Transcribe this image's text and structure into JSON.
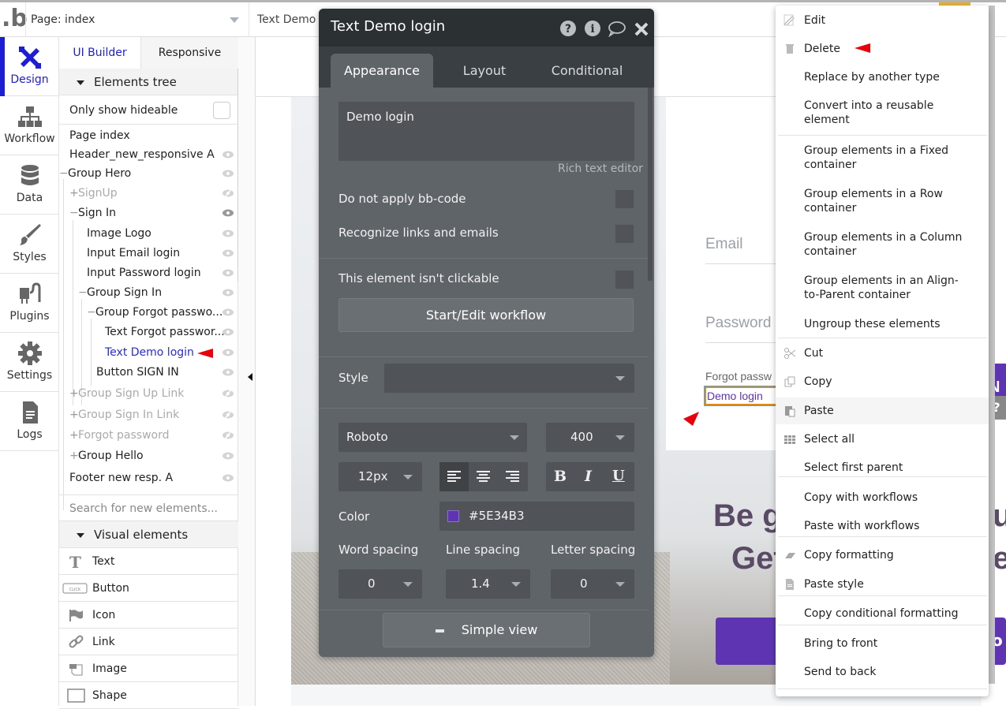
{
  "topbar": {
    "logo": ".b",
    "page_select": "Page: index",
    "element_select": "Text Demo"
  },
  "leftnav": [
    {
      "label": "Design",
      "icon": "design-icon",
      "active": true
    },
    {
      "label": "Workflow",
      "icon": "workflow-icon"
    },
    {
      "label": "Data",
      "icon": "database-icon"
    },
    {
      "label": "Styles",
      "icon": "brush-icon"
    },
    {
      "label": "Plugins",
      "icon": "plug-icon"
    },
    {
      "label": "Settings",
      "icon": "gear-icon"
    },
    {
      "label": "Logs",
      "icon": "document-icon"
    }
  ],
  "panel": {
    "tabs": [
      "UI Builder",
      "Responsive"
    ],
    "elements_tree_heading": "Elements tree",
    "only_show_hideable": "Only show hideable",
    "tree": [
      {
        "label": "Page index",
        "prefix": "",
        "state": "normal",
        "eye": false
      },
      {
        "label": "Header_new_responsive A",
        "prefix": "",
        "state": "normal",
        "eye": "visible"
      },
      {
        "label": "Group Hero",
        "prefix": "−",
        "state": "normal",
        "eye": "visible"
      },
      {
        "label": "SignUp",
        "prefix": "+",
        "state": "hidden",
        "eye": "hidden"
      },
      {
        "label": "Sign In",
        "prefix": "−",
        "state": "normal",
        "eye": "visible-dark"
      },
      {
        "label": "Image Logo",
        "prefix": "",
        "state": "normal",
        "eye": "visible"
      },
      {
        "label": "Input Email login",
        "prefix": "",
        "state": "normal",
        "eye": "visible"
      },
      {
        "label": "Input Password login",
        "prefix": "",
        "state": "normal",
        "eye": "visible"
      },
      {
        "label": "Group Sign In",
        "prefix": "−",
        "state": "normal",
        "eye": "visible"
      },
      {
        "label": "Group Forgot passwo...",
        "prefix": "−",
        "state": "normal",
        "eye": "visible"
      },
      {
        "label": "Text Forgot passwor...",
        "prefix": "",
        "state": "normal",
        "eye": "visible"
      },
      {
        "label": "Text Demo login",
        "prefix": "",
        "state": "selected",
        "eye": "visible"
      },
      {
        "label": "Button SIGN IN",
        "prefix": "",
        "state": "normal",
        "eye": "visible"
      },
      {
        "label": "Group Sign Up Link",
        "prefix": "+",
        "state": "hidden",
        "eye": "hidden"
      },
      {
        "label": "Group Sign In Link",
        "prefix": "+",
        "state": "hidden",
        "eye": "hidden"
      },
      {
        "label": "Forgot password",
        "prefix": "+",
        "state": "hidden",
        "eye": "hidden"
      },
      {
        "label": "Group Hello",
        "prefix": "+",
        "state": "normal",
        "eye": "visible"
      },
      {
        "label": "Footer new resp. A",
        "prefix": "",
        "state": "normal",
        "eye": "visible"
      }
    ],
    "search_placeholder": "Search for new elements...",
    "visual_elements_heading": "Visual elements",
    "visual_elements": [
      {
        "label": "Text",
        "icon": "text-icon"
      },
      {
        "label": "Button",
        "icon": "button-icon"
      },
      {
        "label": "Icon",
        "icon": "flag-icon"
      },
      {
        "label": "Link",
        "icon": "link-icon"
      },
      {
        "label": "Image",
        "icon": "image-icon"
      },
      {
        "label": "Shape",
        "icon": "shape-icon"
      }
    ]
  },
  "editor": {
    "title": "Text Demo login",
    "tabs": [
      "Appearance",
      "Layout",
      "Conditional"
    ],
    "active_tab": "Appearance",
    "content_text": "Demo login",
    "rich_text_label": "Rich text editor",
    "checkboxes": [
      {
        "label": "Do not apply bb-code",
        "checked": false
      },
      {
        "label": "Recognize links and emails",
        "checked": false
      },
      {
        "label": "This element isn't clickable",
        "checked": false
      }
    ],
    "workflow_button": "Start/Edit workflow",
    "style_label": "Style",
    "style_value": "",
    "font_family": "Roboto",
    "font_weight": "400",
    "font_size": "12px",
    "alignment": "left",
    "format_buttons": [
      "B",
      "I",
      "U"
    ],
    "color_label": "Color",
    "color_value": "#5E34B3",
    "word_spacing_label": "Word spacing",
    "line_spacing_label": "Line spacing",
    "letter_spacing_label": "Letter spacing",
    "word_spacing": "0",
    "line_spacing": "1.4",
    "letter_spacing": "0",
    "simple_view_button": "Simple view"
  },
  "canvas": {
    "email_placeholder": "Email",
    "password_placeholder": "Password",
    "forgot_text": "Forgot passw",
    "demo_login_text": "Demo login",
    "signin_btn_partial": "N",
    "hero_title_line1": "Be g",
    "hero_title_line1_right": "u",
    "hero_title_line2": "Get",
    "hero_title_line2_right": "e",
    "hero_btn_partial": "o",
    "help": "?"
  },
  "context_menu": {
    "items": [
      {
        "label": "Edit",
        "icon": "pencil-icon"
      },
      {
        "label": "Delete",
        "icon": "trash-icon"
      },
      {
        "label": "Replace by another type",
        "icon": ""
      },
      {
        "label": "Convert into a reusable element",
        "icon": ""
      },
      {
        "label": "Group elements in a Fixed container",
        "icon": ""
      },
      {
        "label": "Group elements in a Row container",
        "icon": ""
      },
      {
        "label": "Group elements in a Column container",
        "icon": ""
      },
      {
        "label": "Group elements in an Align-to-Parent container",
        "icon": ""
      },
      {
        "label": "Ungroup these elements",
        "icon": ""
      },
      {
        "label": "Cut",
        "icon": "scissors-icon"
      },
      {
        "label": "Copy",
        "icon": "copy-icon"
      },
      {
        "label": "Paste",
        "icon": "paste-icon"
      },
      {
        "label": "Select all",
        "icon": "grid-icon"
      },
      {
        "label": "Select first parent",
        "icon": ""
      },
      {
        "label": "Copy with workflows",
        "icon": ""
      },
      {
        "label": "Paste with workflows",
        "icon": ""
      },
      {
        "label": "Copy formatting",
        "icon": "eraser-icon"
      },
      {
        "label": "Paste style",
        "icon": "file-icon"
      },
      {
        "label": "Copy conditional formatting",
        "icon": ""
      },
      {
        "label": "Bring to front",
        "icon": ""
      },
      {
        "label": "Send to back",
        "icon": ""
      }
    ]
  },
  "colors": {
    "accent": "#1D1DD5",
    "brand_purple": "#5E34B3",
    "annotation_red": "#E8000B"
  }
}
